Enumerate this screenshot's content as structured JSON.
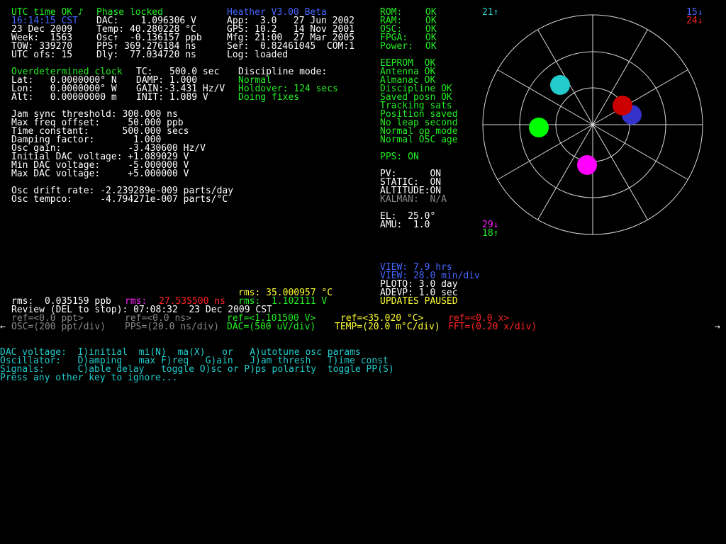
{
  "status": {
    "utc_ok": "UTC time OK ♪",
    "phase": "Phase locked",
    "time": "16:14:15 CST",
    "date": "23 Dec 2009",
    "week": "Week:  1563",
    "tow": "TOW: 339270",
    "utc_ofs": "UTC ofs: 15"
  },
  "receiver": {
    "dac": "DAC:    1.096306 V",
    "temp": "Temp: 40.280228 °C",
    "osc": "Osc↑  -0.136157 ppb",
    "pps": "PPS↑ 369.276184 ns",
    "dly": "Dly:  77.034720 ns"
  },
  "version": {
    "title": "Heather V3.00 Beta",
    "app": "App:  3.0   27 Jun 2002",
    "gps": "GPS: 10.2   14 Nov 2001",
    "mfg": "Mfg: 21:00  27 Mar 2005",
    "ser": "Ser:  0.82461045  COM:1",
    "log": "Log: loaded"
  },
  "health_top": [
    {
      "label": "ROM:    ",
      "value": "OK"
    },
    {
      "label": "RAM:    ",
      "value": "OK"
    },
    {
      "label": "OSC:    ",
      "value": "OK"
    },
    {
      "label": "FPGA:   ",
      "value": "OK"
    },
    {
      "label": "Power:  ",
      "value": "OK"
    }
  ],
  "health_list": [
    "EEPROM  OK",
    "Antenna OK",
    "Almanac OK",
    "Discipline OK",
    "Saved posn OK",
    "Tracking sats",
    "Position saved",
    "No leap second",
    "Normal op mode",
    "Normal OSC age"
  ],
  "pps_on": "PPS: ON",
  "flags": [
    "PV:      ON",
    "STATIC:  ON",
    "ALTITUDE:ON"
  ],
  "kalman": "KALMAN:  N/A",
  "el": "EL:  25.0°",
  "amu": "AMU:  1.0",
  "clock": {
    "header": "Overdetermined clock",
    "lat": "Lat:   0.0000000° N",
    "lon": "Lon:   0.0000000° W",
    "alt": "Alt:   0.00000000 m",
    "tc": "TC:   500.0 sec",
    "damp": "DAMP: 1.000",
    "gain": "GAIN:-3.431 Hz/V",
    "init": "INIT: 1.089 V"
  },
  "discipline": {
    "label": "Discipline mode:",
    "mode": "Normal",
    "holdover": "Holdover: 124 secs",
    "doing": "Doing fixes"
  },
  "params": [
    "Jam sync threshold: 300.000 ns",
    "Max freq offset:     50.000 ppb",
    "Time constant:      500.000 secs",
    "Damping factor:       1.000",
    "Osc gain:            -3.430600 Hz/V",
    "Initial DAC voltage: +1.089029 V",
    "Min DAC voltage:     -5.000000 V",
    "Max DAC voltage:     +5.000000 V"
  ],
  "drift": "Osc drift rate: -2.239289e-009 parts/day",
  "tempco": "Osc tempco:     -4.794271e-007 parts/°C",
  "sats": {
    "s21": "21↑",
    "s15": "15↓",
    "s24": "24↓",
    "s29": "29↓",
    "s18": "18↑"
  },
  "view": {
    "hrs": "VIEW: 7.9 hrs",
    "div": "VIEW: 28.0 min/div",
    "plotq": "PLOTQ: 3.0 day",
    "adevp": "ADEVP: 1.0 sec",
    "paused": "UPDATES PAUSED"
  },
  "rms": {
    "temp": "rms: 35.000957 °C",
    "ppb": "rms:  0.035159 ppb",
    "ns_label": "rms:",
    "ns_value": "27.535500 ns",
    "v": "rms:  1.102111 V"
  },
  "review": "Review (DEL to stop): 07:08:32  23 Dec 2009 CST",
  "refs": {
    "r1": "ref=<0.0 ppt>",
    "r2": "ref=<0.0 ns>",
    "r3": "ref=<1.101500 V>",
    "r4": "ref=<35.020 °C>",
    "r5": "ref=<0.0 x>",
    "d1": "OSC=(200 ppt/div)",
    "d2": "PPS=(20.0 ns/div)",
    "d3": "DAC=(500 uV/div)",
    "d4": "TEMP=(20.0 m°C/div)",
    "d5": "FFT=(0.20 x/div)",
    "arrow_left": "←",
    "arrow_right": "→"
  },
  "menu": [
    "DAC voltage:  I)initial  mi(N)  ma(X)   or   A)utotune osc params",
    "Oscillator:   D)amping   max F)req   G)ain   J)am thresh   T)ime const",
    "Signals:      C)able delay   toggle O)sc or P)ps polarity  toggle PP(S)",
    "Press any other key to ignore..."
  ],
  "colors": {
    "background": "#000000",
    "green": "#22ee22",
    "blue": "#4466ff",
    "cyan": "#22cccc",
    "yellow": "#ffff33",
    "magenta": "#ff22ff",
    "red": "#ff2222",
    "gray": "#888888"
  }
}
